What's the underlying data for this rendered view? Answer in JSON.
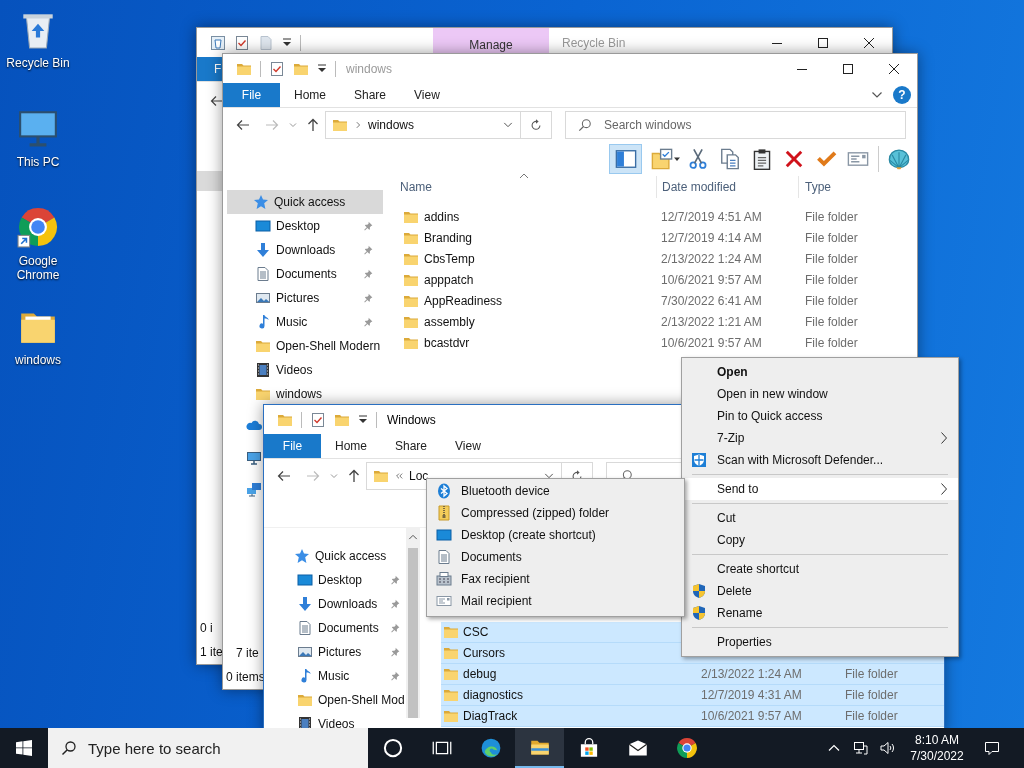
{
  "desktop_icons": [
    {
      "kind": "recycle-bin",
      "label": "Recycle Bin"
    },
    {
      "kind": "pc",
      "label": "This PC"
    },
    {
      "kind": "chrome",
      "label": "Google Chrome"
    },
    {
      "kind": "folder",
      "label": "windows"
    }
  ],
  "recycle_bin_window": {
    "title": "Recycle Bin",
    "active": false,
    "context_tab": "Manage",
    "ribbon_tabs": [
      {
        "label": "F",
        "kind": "file"
      }
    ],
    "status": [
      "0 i",
      "1 ite"
    ]
  },
  "folder_window": {
    "title": "windows",
    "active": false,
    "ribbon_tabs": [
      {
        "label": "File",
        "kind": "file"
      },
      {
        "label": "Home",
        "kind": "tab"
      },
      {
        "label": "Share",
        "kind": "tab"
      },
      {
        "label": "View",
        "kind": "tab"
      }
    ],
    "help": "?",
    "address": {
      "path": "windows"
    },
    "search": {
      "placeholder": "Search windows"
    },
    "toolbar": [
      {
        "kind": "preview-pane",
        "selected": true
      },
      {
        "kind": "properties",
        "selected": false
      },
      {
        "kind": "cut",
        "selected": false
      },
      {
        "kind": "copy",
        "selected": false
      },
      {
        "kind": "paste",
        "selected": false
      },
      {
        "kind": "delete",
        "selected": false
      },
      {
        "kind": "check",
        "selected": false
      },
      {
        "kind": "mail",
        "selected": false
      },
      {
        "kind": "shell",
        "selected": false
      }
    ],
    "columns": [
      "Name",
      "Date modified",
      "Type"
    ],
    "nav": [
      {
        "kind": "quick-access",
        "label": "Quick access",
        "selected": true,
        "pinned": false
      },
      {
        "kind": "desktop",
        "label": "Desktop",
        "selected": false,
        "pinned": true
      },
      {
        "kind": "downloads",
        "label": "Downloads",
        "selected": false,
        "pinned": true
      },
      {
        "kind": "documents",
        "label": "Documents",
        "selected": false,
        "pinned": true
      },
      {
        "kind": "pictures",
        "label": "Pictures",
        "selected": false,
        "pinned": true
      },
      {
        "kind": "music",
        "label": "Music",
        "selected": false,
        "pinned": true
      },
      {
        "kind": "folder",
        "label": "Open-Shell Modern",
        "selected": false,
        "pinned": false
      },
      {
        "kind": "videos",
        "label": "Videos",
        "selected": false,
        "pinned": false
      },
      {
        "kind": "folder",
        "label": "windows",
        "selected": false,
        "pinned": false
      },
      {
        "kind": "onedrive",
        "selected": false,
        "pinned": false
      },
      {
        "kind": "pc",
        "selected": false,
        "pinned": false
      },
      {
        "kind": "network",
        "selected": false,
        "pinned": false
      }
    ],
    "rows": [
      {
        "name": "addins",
        "date": "12/7/2019 4:51 AM",
        "type": "File folder",
        "selected": false
      },
      {
        "name": "Branding",
        "date": "12/7/2019 4:14 AM",
        "type": "File folder",
        "selected": false
      },
      {
        "name": "CbsTemp",
        "date": "2/13/2022 1:24 AM",
        "type": "File folder",
        "selected": false
      },
      {
        "name": "apppatch",
        "date": "10/6/2021 9:57 AM",
        "type": "File folder",
        "selected": false
      },
      {
        "name": "AppReadiness",
        "date": "7/30/2022 6:41 AM",
        "type": "File folder",
        "selected": false
      },
      {
        "name": "assembly",
        "date": "2/13/2022 1:21 AM",
        "type": "File folder",
        "selected": false
      },
      {
        "name": "bcastdvr",
        "date": "10/6/2021 9:57 AM",
        "type": "File folder",
        "selected": false
      }
    ],
    "status": [
      "7 ite",
      "0 items"
    ]
  },
  "active_window": {
    "title": "Windows",
    "active": true,
    "ribbon_tabs": [
      {
        "label": "File",
        "kind": "file"
      },
      {
        "label": "Home",
        "kind": "tab"
      },
      {
        "label": "Share",
        "kind": "tab"
      },
      {
        "label": "View",
        "kind": "tab"
      }
    ],
    "address": {
      "path": "Loc"
    },
    "nav": [
      {
        "kind": "quick-access",
        "label": "Quick access",
        "selected": false,
        "pinned": false
      },
      {
        "kind": "desktop",
        "label": "Desktop",
        "selected": false,
        "pinned": true
      },
      {
        "kind": "downloads",
        "label": "Downloads",
        "selected": false,
        "pinned": true
      },
      {
        "kind": "documents",
        "label": "Documents",
        "selected": false,
        "pinned": true
      },
      {
        "kind": "pictures",
        "label": "Pictures",
        "selected": false,
        "pinned": true
      },
      {
        "kind": "music",
        "label": "Music",
        "selected": false,
        "pinned": true
      },
      {
        "kind": "folder",
        "label": "Open-Shell Mod",
        "selected": false,
        "pinned": false
      },
      {
        "kind": "videos",
        "label": "Videos",
        "selected": false,
        "pinned": false
      }
    ],
    "rows": [
      {
        "name": "CSC",
        "selected": true
      },
      {
        "name": "Cursors",
        "selected": true
      },
      {
        "name": "debug",
        "date": "2/13/2022 1:24 AM",
        "type": "File folder",
        "selected": true
      },
      {
        "name": "diagnostics",
        "date": "12/7/2019 4:31 AM",
        "type": "File folder",
        "selected": true
      },
      {
        "name": "DiagTrack",
        "date": "10/6/2021 9:57 AM",
        "type": "File folder",
        "selected": true
      }
    ]
  },
  "context_menu": [
    {
      "kind": "command",
      "label": "Open",
      "default": true,
      "selected": false
    },
    {
      "kind": "command",
      "label": "Open in new window",
      "default": false,
      "selected": false
    },
    {
      "kind": "command",
      "label": "Pin to Quick access",
      "default": false,
      "selected": false
    },
    {
      "kind": "submenu",
      "label": "7-Zip",
      "default": false,
      "selected": false
    },
    {
      "kind": "defender",
      "label": "Scan with Microsoft Defender...",
      "default": false,
      "selected": false
    },
    {
      "kind": "separator"
    },
    {
      "kind": "submenu",
      "label": "Send to",
      "default": false,
      "selected": true
    },
    {
      "kind": "separator"
    },
    {
      "kind": "command",
      "label": "Cut",
      "default": false,
      "selected": false
    },
    {
      "kind": "command",
      "label": "Copy",
      "default": false,
      "selected": false
    },
    {
      "kind": "separator"
    },
    {
      "kind": "command",
      "label": "Create shortcut",
      "default": false,
      "selected": false
    },
    {
      "kind": "uac",
      "label": "Delete",
      "default": false,
      "selected": false
    },
    {
      "kind": "uac",
      "label": "Rename",
      "default": false,
      "selected": false
    },
    {
      "kind": "separator"
    },
    {
      "kind": "command",
      "label": "Properties",
      "default": false,
      "selected": false
    }
  ],
  "send_to_menu": [
    {
      "kind": "bluetooth",
      "label": "Bluetooth device"
    },
    {
      "kind": "zip",
      "label": "Compressed (zipped) folder"
    },
    {
      "kind": "desktop",
      "label": "Desktop (create shortcut)"
    },
    {
      "kind": "documents",
      "label": "Documents"
    },
    {
      "kind": "fax",
      "label": "Fax recipient"
    },
    {
      "kind": "mail",
      "label": "Mail recipient"
    }
  ],
  "taskbar": {
    "search": {
      "placeholder": "Type here to search"
    },
    "buttons": [
      {
        "kind": "cortana",
        "active": false
      },
      {
        "kind": "task-view",
        "active": false
      },
      {
        "kind": "edge",
        "active": false
      },
      {
        "kind": "explorer",
        "active": true
      },
      {
        "kind": "store",
        "active": false
      },
      {
        "kind": "mail",
        "active": false
      },
      {
        "kind": "chrome",
        "active": false
      }
    ],
    "time": "8:10 AM",
    "date": "7/30/2022"
  }
}
